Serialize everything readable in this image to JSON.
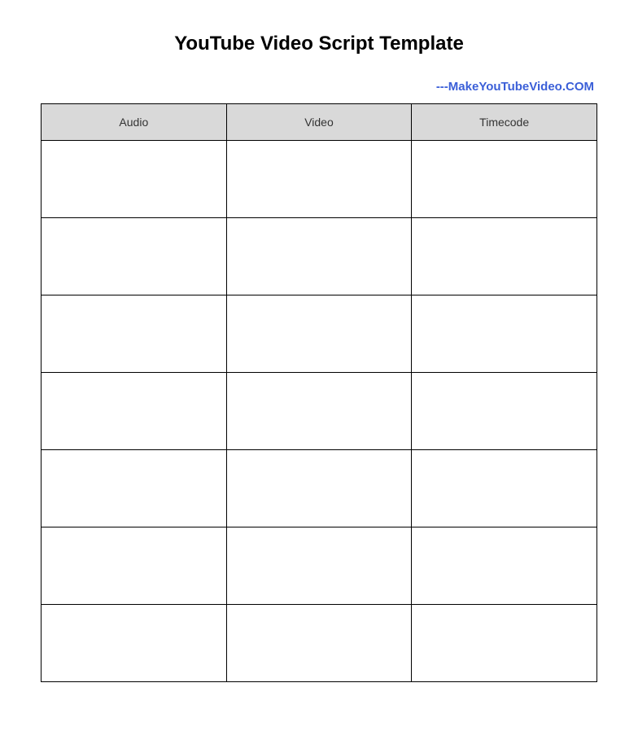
{
  "title": "YouTube Video Script Template",
  "attribution": "---MakeYouTubeVideo.COM",
  "columns": {
    "col1": "Audio",
    "col2": "Video",
    "col3": "Timecode"
  },
  "rows": [
    {
      "audio": "",
      "video": "",
      "timecode": ""
    },
    {
      "audio": "",
      "video": "",
      "timecode": ""
    },
    {
      "audio": "",
      "video": "",
      "timecode": ""
    },
    {
      "audio": "",
      "video": "",
      "timecode": ""
    },
    {
      "audio": "",
      "video": "",
      "timecode": ""
    },
    {
      "audio": "",
      "video": "",
      "timecode": ""
    },
    {
      "audio": "",
      "video": "",
      "timecode": ""
    }
  ]
}
